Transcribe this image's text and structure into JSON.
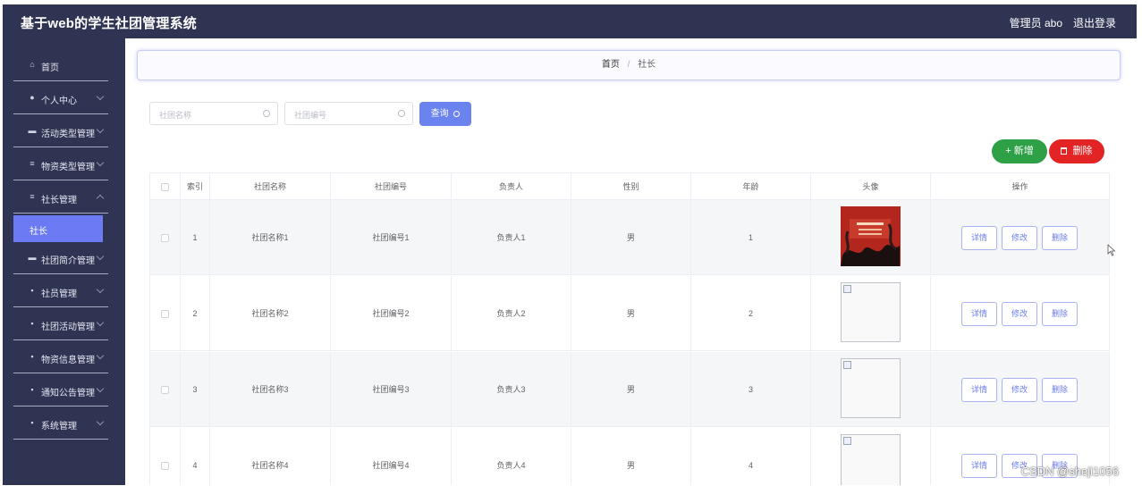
{
  "app": {
    "title": "基于web的学生社团管理系统",
    "user": "管理员 abo",
    "logout": "退出登录"
  },
  "sidebar": {
    "items": [
      {
        "label": "首页",
        "icon": "⌂"
      },
      {
        "label": "个人中心",
        "icon": "●"
      },
      {
        "label": "活动类型管理",
        "icon": "▬"
      },
      {
        "label": "物资类型管理",
        "icon": "≡"
      },
      {
        "label": "社长管理",
        "icon": "≡"
      },
      {
        "label": "社团简介管理",
        "icon": "▬"
      },
      {
        "label": "社员管理",
        "icon": "▪"
      },
      {
        "label": "社团活动管理",
        "icon": "▪"
      },
      {
        "label": "物资信息管理",
        "icon": "▪"
      },
      {
        "label": "通知公告管理",
        "icon": "▪"
      },
      {
        "label": "系统管理",
        "icon": "▪"
      }
    ],
    "active_sub": "社长"
  },
  "breadcrumb": {
    "home": "首页",
    "sep": "/",
    "current": "社长"
  },
  "search": {
    "name_placeholder": "社团名称",
    "code_placeholder": "社团编号",
    "query_label": "查询"
  },
  "actions": {
    "add_label": "+ 新增",
    "delete_label": "删除"
  },
  "table": {
    "headers": [
      "索引",
      "社团名称",
      "社团编号",
      "负责人",
      "性别",
      "年龄",
      "头像",
      "操作"
    ],
    "rows": [
      {
        "index": "1",
        "name": "社团名称1",
        "code": "社团编号1",
        "leader": "负责人1",
        "gender": "男",
        "age": "1"
      },
      {
        "index": "2",
        "name": "社团名称2",
        "code": "社团编号2",
        "leader": "负责人2",
        "gender": "男",
        "age": "2"
      },
      {
        "index": "3",
        "name": "社团名称3",
        "code": "社团编号3",
        "leader": "负责人3",
        "gender": "男",
        "age": "3"
      },
      {
        "index": "4",
        "name": "社团名称4",
        "code": "社团编号4",
        "leader": "负责人4",
        "gender": "男",
        "age": "4"
      }
    ],
    "op_labels": {
      "detail": "详情",
      "edit": "修改",
      "delete": "删除"
    }
  },
  "watermark": "CSDN @sheji1056",
  "colors": {
    "topbar": "#2f3453",
    "sidebar": "#2f3453",
    "accent": "#6c7bf3",
    "add": "#2ea046",
    "delete": "#e32424"
  }
}
